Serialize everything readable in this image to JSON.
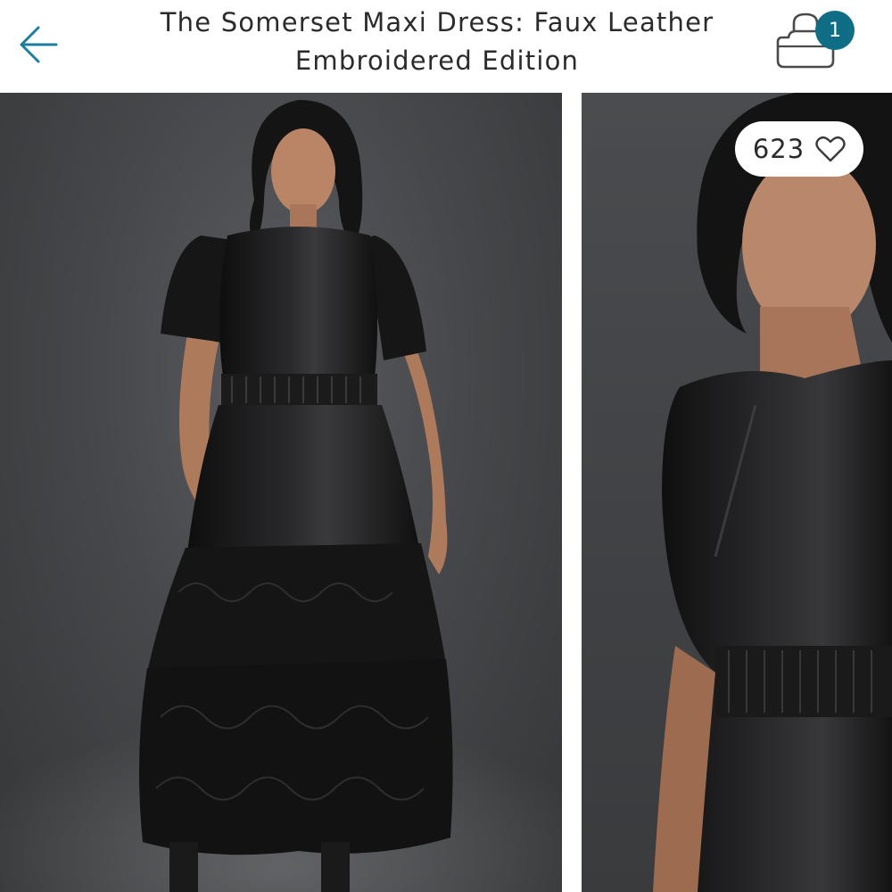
{
  "header": {
    "back_icon": "arrow-left-icon",
    "title_line1": "The Somerset Maxi Dress: Faux Leather",
    "title_line2": "Embroidered Edition",
    "bag_icon": "shopping-bag-icon",
    "bag_count": "1"
  },
  "gallery": {
    "like": {
      "count": "623",
      "icon": "heart-outline-icon"
    }
  },
  "colors": {
    "accent": "#0f6e85",
    "back_arrow": "#1c7fa0",
    "text": "#2b2b2b"
  }
}
